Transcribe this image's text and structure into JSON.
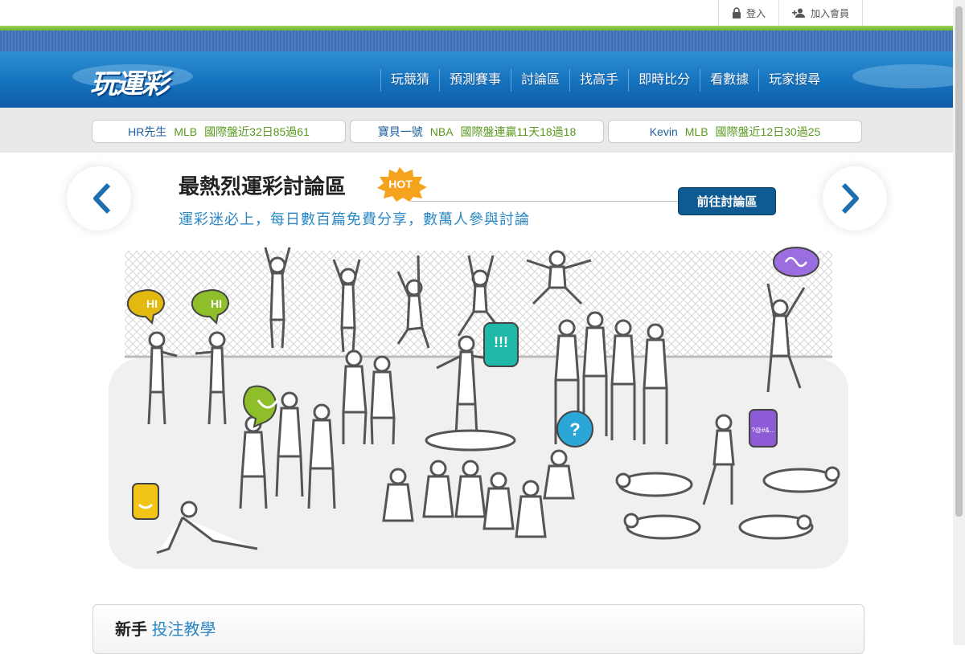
{
  "top_links": {
    "login": "登入",
    "register": "加入會員"
  },
  "logo": "玩運彩",
  "nav": [
    "玩競猜",
    "預測賽事",
    "討論區",
    "找高手",
    "即時比分",
    "看數據",
    "玩家搜尋"
  ],
  "tickers": [
    {
      "name": "HR先生",
      "league": "MLB",
      "stat": "國際盤近32日85過61"
    },
    {
      "name": "寶貝一號",
      "league": "NBA",
      "stat": "國際盤連贏11天18過18"
    },
    {
      "name": "Kevin",
      "league": "MLB",
      "stat": "國際盤近12日30過25"
    }
  ],
  "hero": {
    "title": "最熱烈運彩討論區",
    "badge": "HOT",
    "subtitle": "運彩迷必上，每日數百篇免費分享，數萬人參與討論",
    "button": "前往討論區",
    "bubbles": [
      "HI",
      "HI",
      "!!!",
      "?",
      "?@#&..."
    ]
  },
  "panel": {
    "bold": "新手",
    "accent": "投注教學"
  },
  "colors": {
    "nav_blue": "#1572bd",
    "accent_green": "#6cb32a",
    "link_blue": "#2a88c6",
    "button_navy": "#0f5a91",
    "hot_orange": "#f5a21c"
  }
}
